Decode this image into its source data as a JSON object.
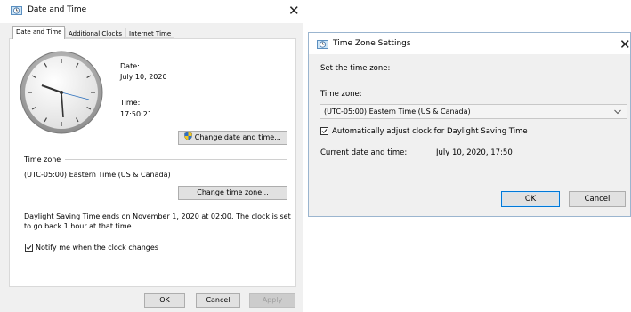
{
  "date_time_dialog": {
    "title": "Date and Time",
    "tabs": [
      "Date and Time",
      "Additional Clocks",
      "Internet Time"
    ],
    "date_label": "Date:",
    "date_value": "July 10, 2020",
    "time_label": "Time:",
    "time_value": "17:50:21",
    "change_date_time_button": "Change date and time...",
    "time_zone_section": "Time zone",
    "time_zone_value": "(UTC-05:00) Eastern Time (US & Canada)",
    "change_time_zone_button": "Change time zone...",
    "dst_line1": "Daylight Saving Time ends on November 1, 2020 at 02:00. The clock is set",
    "dst_line2": "to go back 1 hour at that time.",
    "notify_checkbox_label": "Notify me when the clock changes",
    "notify_checked": true,
    "ok_button": "OK",
    "cancel_button": "Cancel",
    "apply_button": "Apply"
  },
  "time_zone_dialog": {
    "title": "Time Zone Settings",
    "instruction": "Set the time zone:",
    "time_zone_label": "Time zone:",
    "time_zone_selected": "(UTC-05:00) Eastern Time (US & Canada)",
    "dst_checkbox_label": "Automatically adjust clock for Daylight Saving Time",
    "dst_checked": true,
    "current_label": "Current date and time:",
    "current_value": "July 10, 2020, 17:50",
    "ok_button": "OK",
    "cancel_button": "Cancel"
  },
  "icons": {
    "window_icon": "clock-window-icon",
    "shield_icon": "uac-shield-icon",
    "close_icon": "close-icon",
    "dropdown_icon": "chevron-down-icon"
  },
  "colors": {
    "accent": "#0078d7",
    "dialog_bg": "#f0f0f0",
    "panel_bg": "#ffffff"
  }
}
